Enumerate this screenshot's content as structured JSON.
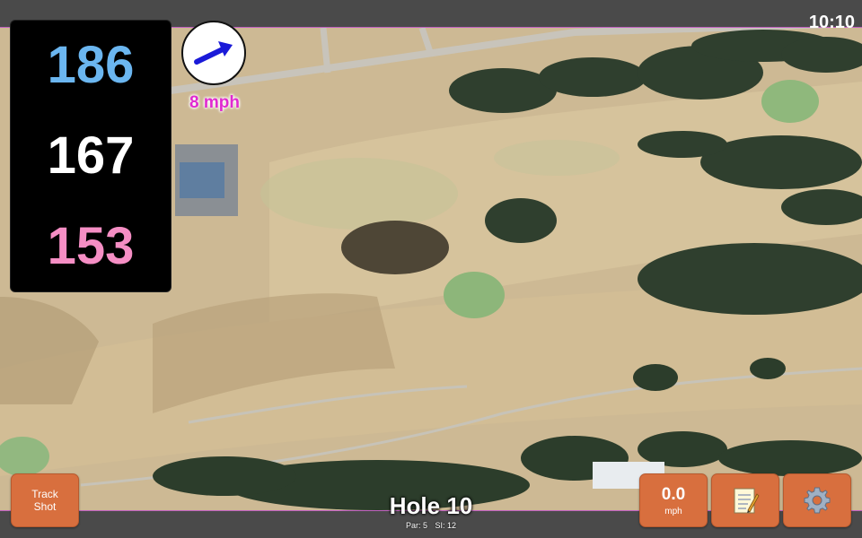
{
  "status": {
    "time": "10:10"
  },
  "distances": {
    "back": "186",
    "middle": "167",
    "front": "153"
  },
  "wind": {
    "speed_label": "8 mph",
    "icon": "arrow-icon"
  },
  "hole": {
    "title": "Hole 10",
    "par_label": "Par: 5",
    "si_label": "SI: 12"
  },
  "buttons": {
    "track_shot_line1": "Track",
    "track_shot_line2": "Shot",
    "speed_value": "0.0",
    "speed_unit": "mph",
    "notes_icon": "notepad-icon",
    "settings_icon": "gear-icon"
  },
  "colors": {
    "back_distance": "#6bb6f0",
    "middle_distance": "#ffffff",
    "front_distance": "#f58ec4",
    "button": "#d86f3e",
    "wind_text": "#e02ad0"
  }
}
